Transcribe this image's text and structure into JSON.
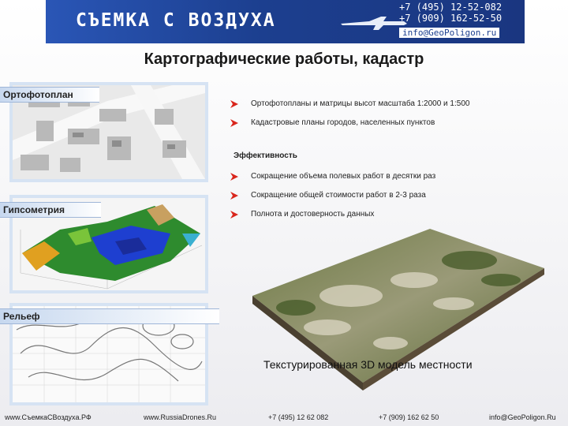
{
  "header": {
    "brand": "СЪЕМКА С ВОЗДУХА",
    "phone1": "+7 (495) 12-52-082",
    "phone2": "+7 (909) 162-52-50",
    "email": "info@GeoPoligon.ru"
  },
  "title": "Картографические работы, кадастр",
  "panels": {
    "ortho": "Ортофотоплан",
    "gips": "Гипсометрия",
    "relief": "Рельеф"
  },
  "bullets_top": [
    "Ортофотопланы и матрицы высот масштаба 1:2000 и 1:500",
    "Кадастровые планы городов, населенных пунктов"
  ],
  "efficiency_heading": "Эффективность",
  "bullets_eff": [
    "Сокращение объема полевых работ в десятки раз",
    "Сокращение общей стоимости работ в 2-3 раза",
    "Полнота и достоверность данных"
  ],
  "model_caption": "Текстурированная 3D модель местности",
  "footer": {
    "site1": "www.СъемкаСВоздуха.РФ",
    "site2": "www.RussiaDrones.Ru",
    "phone1": "+7 (495) 12 62 082",
    "phone2": "+7 (909) 162 62 50",
    "email": "info@GeoPoligon.Ru"
  },
  "colors": {
    "banner": "#1c3f8f",
    "accent_arrow": "#d9261c",
    "label_bg": "#c7d8ef"
  }
}
